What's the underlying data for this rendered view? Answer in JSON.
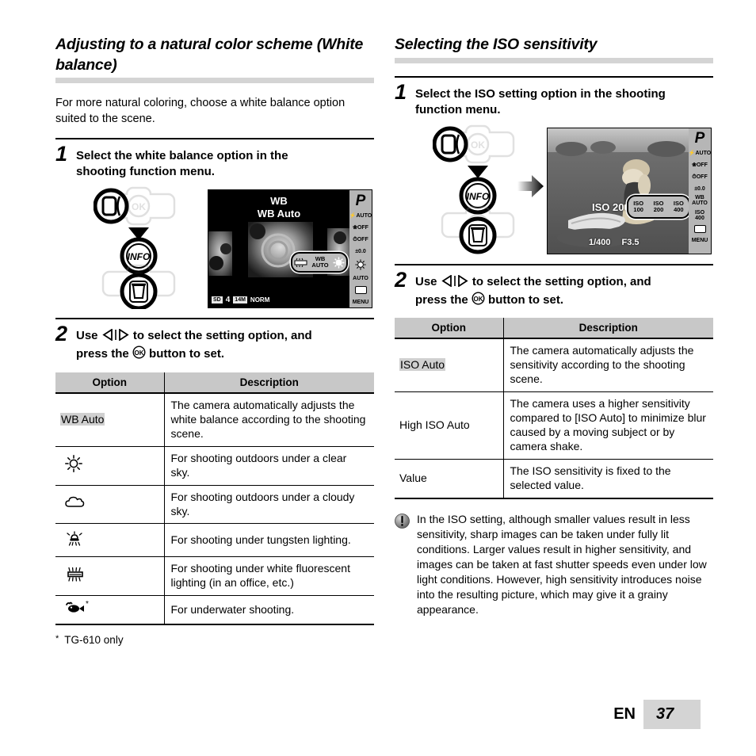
{
  "page": {
    "lang_label": "EN",
    "page_number": "37"
  },
  "left": {
    "heading": "Adjusting to a natural color scheme (White balance)",
    "intro": "For more natural coloring, choose a white balance option suited to the scene.",
    "step1": {
      "number": "1",
      "text_a": "Select the white balance option in the",
      "text_b": "shooting function menu."
    },
    "lcd": {
      "title_line1": "WB",
      "title_line2": "WB Auto",
      "side": [
        "P",
        "AUTO",
        "OFF",
        "OFF",
        "±0.0",
        "WB AUTO",
        "AUTO",
        "",
        "MENU"
      ],
      "side_mode": "P",
      "side_flash": "AUTO",
      "side_macro": "OFF",
      "side_timer": "OFF",
      "side_exposure": "±0.0",
      "side_iso": "AUTO",
      "side_menu": "MENU",
      "selection": [
        "",
        "WB AUTO",
        ""
      ],
      "status": {
        "card": "SD",
        "count": "4",
        "size": "14M",
        "quality": "NORM"
      }
    },
    "step2": {
      "number": "2",
      "text_a": "Use",
      "text_b": "to select the setting option, and",
      "text_c": "press the",
      "text_d": "button to set."
    },
    "table": {
      "headers": [
        "Option",
        "Description"
      ],
      "rows": [
        {
          "option": "WB Auto",
          "option_icon": "",
          "highlight": true,
          "description": "The camera automatically adjusts the white balance according to the shooting scene."
        },
        {
          "option": "",
          "option_icon": "sun-icon",
          "highlight": false,
          "description": "For shooting outdoors under a clear sky."
        },
        {
          "option": "",
          "option_icon": "cloud-icon",
          "highlight": false,
          "description": "For shooting outdoors under a cloudy sky."
        },
        {
          "option": "",
          "option_icon": "tungsten-lamp-icon",
          "highlight": false,
          "description": "For shooting under tungsten lighting."
        },
        {
          "option": "",
          "option_icon": "fluorescent-tube-icon",
          "highlight": false,
          "description": "For shooting under white fluorescent lighting (in an office, etc.)"
        },
        {
          "option": "",
          "option_icon": "underwater-fish-icon",
          "highlight": false,
          "description": "For underwater shooting."
        }
      ]
    },
    "footnote": {
      "marker": "*",
      "text": "TG-610 only"
    }
  },
  "right": {
    "heading": "Selecting the ISO sensitivity",
    "step1": {
      "number": "1",
      "text_a": "Select the ISO setting option in the shooting",
      "text_b": "function menu."
    },
    "lcd": {
      "iso_label": "ISO 200",
      "shutter": "1/400",
      "aperture": "F3.5",
      "side_mode": "P",
      "side_flash": "AUTO",
      "side_macro": "OFF",
      "side_timer": "OFF",
      "side_exposure": "±0.0",
      "side_wb": "WB AUTO",
      "side_iso_top": "ISO",
      "side_iso_bottom": "400",
      "side_menu": "MENU",
      "selection": [
        {
          "top": "ISO",
          "bottom": "100"
        },
        {
          "top": "ISO",
          "bottom": "200"
        },
        {
          "top": "ISO",
          "bottom": "400"
        }
      ]
    },
    "step2": {
      "number": "2",
      "text_a": "Use",
      "text_b": "to select the setting option, and",
      "text_c": "press the",
      "text_d": "button to set."
    },
    "table": {
      "headers": [
        "Option",
        "Description"
      ],
      "rows": [
        {
          "option": "ISO Auto",
          "highlight": true,
          "description": "The camera automatically adjusts the sensitivity according to the shooting scene."
        },
        {
          "option": "High ISO Auto",
          "highlight": false,
          "description": "The camera uses a higher sensitivity compared to [ISO Auto] to minimize blur caused by a moving subject or by camera shake."
        },
        {
          "option": "Value",
          "highlight": false,
          "description": "The ISO sensitivity is fixed to the selected value."
        }
      ]
    },
    "note": {
      "text": "In the ISO setting, although smaller values result in less sensitivity, sharp images can be taken under fully lit conditions. Larger values result in higher sensitivity, and images can be taken at fast shutter speeds even under low light conditions. However, high sensitivity introduces noise into the resulting picture, which may give it a grainy appearance."
    }
  }
}
